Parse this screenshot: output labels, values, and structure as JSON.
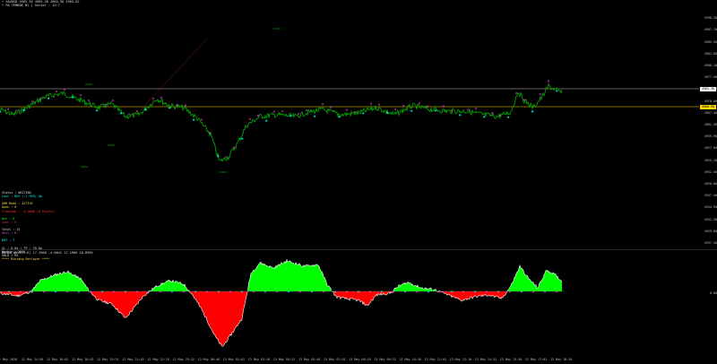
{
  "header": {
    "line1": "• XAUUSD  4965.36 4965.38 4965.36 4965.62",
    "line2": "• PA TEMBAK  M1 | Server : 12:7"
  },
  "status_panel": [
    {
      "text": "Status : WAITING",
      "color": "#dddddd"
    },
    {
      "text": "Last : BUY (-7.995) 0p",
      "color": "#00ffff"
    },
    {
      "text": "",
      "color": "#000000"
    },
    {
      "text": "ARM Mode : ACTIVE",
      "color": "#ffd84a"
    },
    {
      "text": "Open : 0",
      "color": "#ffd84a"
    },
    {
      "text": "Floating : -0.0000 (0 Points)",
      "color": "#ff3030"
    },
    {
      "text": "",
      "color": "#000000"
    },
    {
      "text": "Win : 0",
      "color": "#00ff00"
    },
    {
      "text": "Loss : 0",
      "color": "#ff3030"
    },
    {
      "text": "",
      "color": "#000000"
    },
    {
      "text": "Total : 15",
      "color": "#dddddd"
    },
    {
      "text": "Sell : 8",
      "color": "#ff55ff"
    },
    {
      "text": "",
      "color": "#000000"
    },
    {
      "text": "BUY : 7",
      "color": "#00ffff"
    },
    {
      "text": "",
      "color": "#000000"
    },
    {
      "text": "SL : 0.0s | TP : 25.0p",
      "color": "#dddddd"
    },
    {
      "text": "Martin : 200%",
      "color": "#dddddd"
    },
    {
      "text": "GOLD / M1",
      "color": "#dddddd"
    },
    {
      "text": "**** Bintang Berlayar ****",
      "color": "#ffd84a"
    }
  ],
  "price_axis": [
    "4993.40",
    "4990.30",
    "4987.70",
    "4985.50",
    "4982.60",
    "4980.10",
    "4977.50",
    "4972.60",
    "4970.00",
    "4967.40",
    "4962.30",
    "4959.90",
    "4957.60",
    "4955.10",
    "4952.50",
    "4950.00",
    "4947.40",
    "4944.90",
    "4942.30",
    "4939.80",
    "4937.40"
  ],
  "price_tags": {
    "current": {
      "text": "4965.36",
      "bg": "#ffffff"
    },
    "level": {
      "text": "4960.90",
      "bg": "#ffd800"
    }
  },
  "indicator": {
    "header": "BBMAQ WAVE(1.6) 17.1908 -4.6641 17.1908 18.8965",
    "axis_zero": "0.00"
  },
  "time_axis": [
    "12 May 2026",
    "12 May 14:50",
    "12 May 16:02",
    "12 May 18:02",
    "12 May 19:31",
    "12 May 21:02",
    "12 May 22:16",
    "12 May 23:32",
    "13 May 00:48",
    "13 May 02:02",
    "13 May 03:16",
    "13 May 04:32",
    "13 May 05:48",
    "13 May 07:02",
    "13 May 08:16",
    "13 May 09:32",
    "13 May 10:48",
    "13 May 12:02",
    "13 May 13:16",
    "13 May 14:32",
    "13 May 15:48",
    "13 May 17:02",
    "13 May 18:16"
  ],
  "colors": {
    "price_line": "#00b400",
    "sell_marker": "#ff44ff",
    "buy_marker": "#00ffff",
    "hline_white": "#bfbfbf",
    "hline_yellow": "#ffd800",
    "trend_line": "#8b1a1a",
    "ind_up": "#00ff00",
    "ind_down": "#ff0000",
    "ind_line": "#ffffff"
  }
}
